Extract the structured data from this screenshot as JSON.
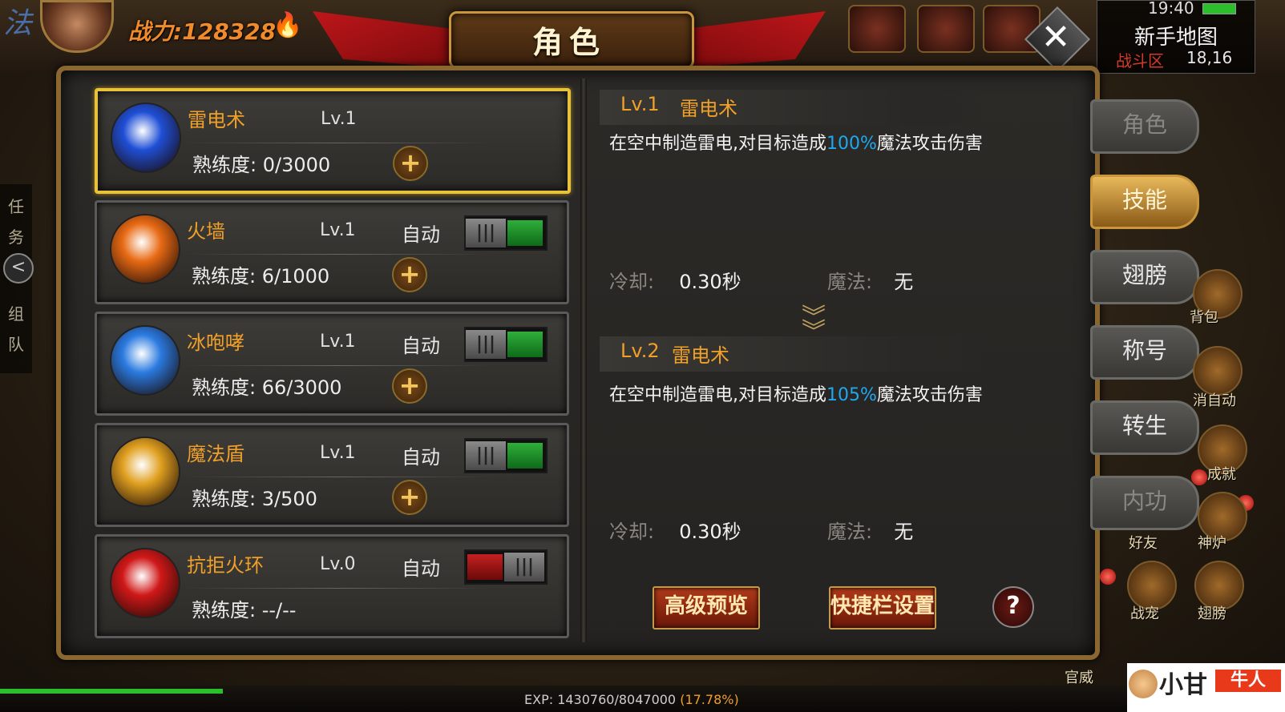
{
  "hud": {
    "corner_char": "法",
    "power_label": "战力:",
    "power_value": "128328",
    "time": "19:40",
    "map_name": "新手地图",
    "zone": "战斗区",
    "coords": "18,16"
  },
  "window": {
    "title": "角色",
    "close_label": "✕"
  },
  "skills": [
    {
      "name": "雷电术",
      "level": "Lv.1",
      "auto": "",
      "prof_label": "熟练度:",
      "prof": "0/3000",
      "toggle": null,
      "selected": true,
      "color": "#1f4fd6"
    },
    {
      "name": "火墙",
      "level": "Lv.1",
      "auto": "自动",
      "prof_label": "熟练度:",
      "prof": "6/1000",
      "toggle": "on",
      "selected": false,
      "color": "#e86a14"
    },
    {
      "name": "冰咆哮",
      "level": "Lv.1",
      "auto": "自动",
      "prof_label": "熟练度:",
      "prof": "66/3000",
      "toggle": "on",
      "selected": false,
      "color": "#2a7ae0"
    },
    {
      "name": "魔法盾",
      "level": "Lv.1",
      "auto": "自动",
      "prof_label": "熟练度:",
      "prof": "3/500",
      "toggle": "on",
      "selected": false,
      "color": "#e0a020"
    },
    {
      "name": "抗拒火环",
      "level": "Lv.0",
      "auto": "自动",
      "prof_label": "熟练度:",
      "prof": "--/--",
      "toggle": "off",
      "selected": false,
      "color": "#d01818"
    }
  ],
  "toggle_knob": "|||",
  "plus_label": "+",
  "detail": {
    "levels": [
      {
        "lv": "Lv.1",
        "name": "雷电术",
        "desc_pre": "在空中制造雷电,对目标造成",
        "desc_pct": "100%",
        "desc_post": "魔法攻击伤害",
        "cd_label": "冷却:",
        "cd": "0.30秒",
        "mp_label": "魔法:",
        "mp": "无"
      },
      {
        "lv": "Lv.2",
        "name": "雷电术",
        "desc_pre": "在空中制造雷电,对目标造成",
        "desc_pct": "105%",
        "desc_post": "魔法攻击伤害",
        "cd_label": "冷却:",
        "cd": "0.30秒",
        "mp_label": "魔法:",
        "mp": "无"
      }
    ],
    "btn_preview": "高级预览",
    "btn_quickbar": "快捷栏设置",
    "help": "?"
  },
  "tabs": [
    {
      "label": "角色",
      "state": "dim"
    },
    {
      "label": "技能",
      "state": "active"
    },
    {
      "label": "翅膀",
      "state": "normal"
    },
    {
      "label": "称号",
      "state": "normal"
    },
    {
      "label": "转生",
      "state": "normal"
    },
    {
      "label": "内功",
      "state": "dim"
    }
  ],
  "left_side": {
    "task_1": "任",
    "task_2": "务",
    "team_1": "组",
    "team_2": "队",
    "back": "<"
  },
  "side_icons": {
    "bag": "背包",
    "cancel_auto": "消自动",
    "achievement": "成就",
    "friends": "好友",
    "furnace": "神炉",
    "battle_pet": "战宠",
    "wings": "翅膀",
    "rank": "官威"
  },
  "exp": {
    "label": "EXP: 1430760/8047000",
    "pct": "(17.78%)"
  },
  "watermark": {
    "text": "小甘",
    "badge": "牛人"
  }
}
